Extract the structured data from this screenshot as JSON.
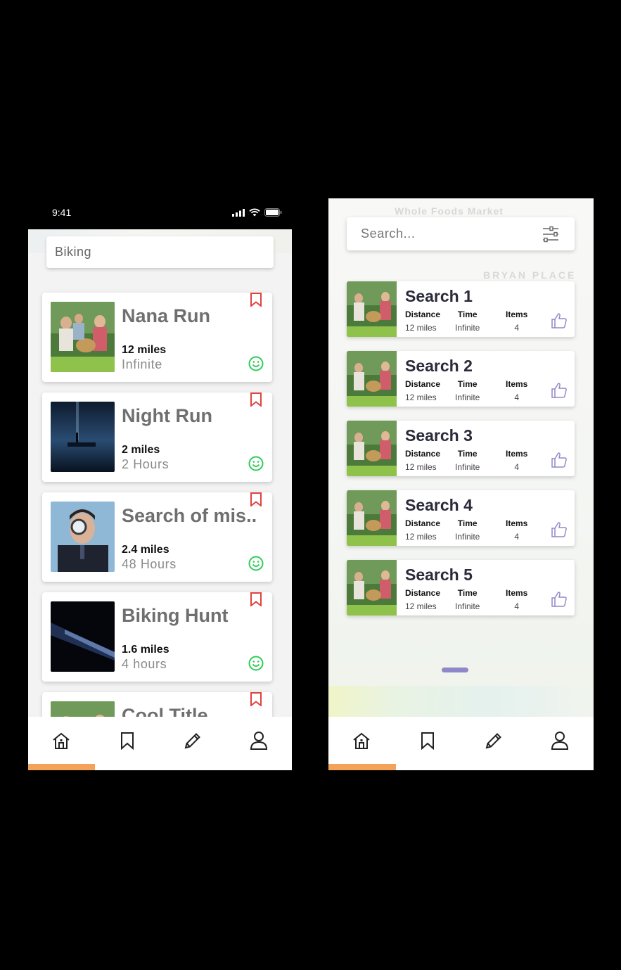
{
  "left_phone": {
    "status_time": "9:41",
    "search": {
      "value": "Biking"
    },
    "cards": [
      {
        "title": "Nana Run",
        "distance": "12 miles",
        "time": "Infinite",
        "thumb": "family-photo"
      },
      {
        "title": "Night Run",
        "distance": "2 miles",
        "time": "2 Hours",
        "thumb": "night-lake-photo"
      },
      {
        "title": "Search of mis..",
        "distance": "2.4 miles",
        "time": "48 Hours",
        "thumb": "detective-photo"
      },
      {
        "title": "Biking Hunt",
        "distance": "1.6 miles",
        "time": "4 hours",
        "thumb": "flashlight-photo"
      },
      {
        "title": "Cool Title",
        "thumb": "family-photo"
      }
    ],
    "active_tab": "home"
  },
  "right_phone": {
    "map_labels": [
      "Whole Foods Market",
      "BRYAN PLACE"
    ],
    "search": {
      "placeholder": "Search..."
    },
    "cards": [
      {
        "title": "Search 1",
        "distance_label": "Distance",
        "distance": "12 miles",
        "time_label": "Time",
        "time": "Infinite",
        "items_label": "Items",
        "items": "4"
      },
      {
        "title": "Search 2",
        "distance_label": "Distance",
        "distance": "12 miles",
        "time_label": "Time",
        "time": "Infinite",
        "items_label": "Items",
        "items": "4"
      },
      {
        "title": "Search 3",
        "distance_label": "Distance",
        "distance": "12 miles",
        "time_label": "Time",
        "time": "Infinite",
        "items_label": "Items",
        "items": "4"
      },
      {
        "title": "Search 4",
        "distance_label": "Distance",
        "distance": "12 miles",
        "time_label": "Time",
        "time": "Infinite",
        "items_label": "Items",
        "items": "4"
      },
      {
        "title": "Search 5",
        "distance_label": "Distance",
        "distance": "12 miles",
        "time_label": "Time",
        "time": "Infinite",
        "items_label": "Items",
        "items": "4"
      }
    ],
    "active_tab": "home"
  },
  "nav_icons": [
    "home-icon",
    "bookmark-icon",
    "pencil-icon",
    "user-icon"
  ],
  "colors": {
    "accent_orange": "#f4a25a",
    "bookmark_red": "#e0443e",
    "smiley_green": "#2ecc5a",
    "thumb_purple": "#8f88c8"
  }
}
